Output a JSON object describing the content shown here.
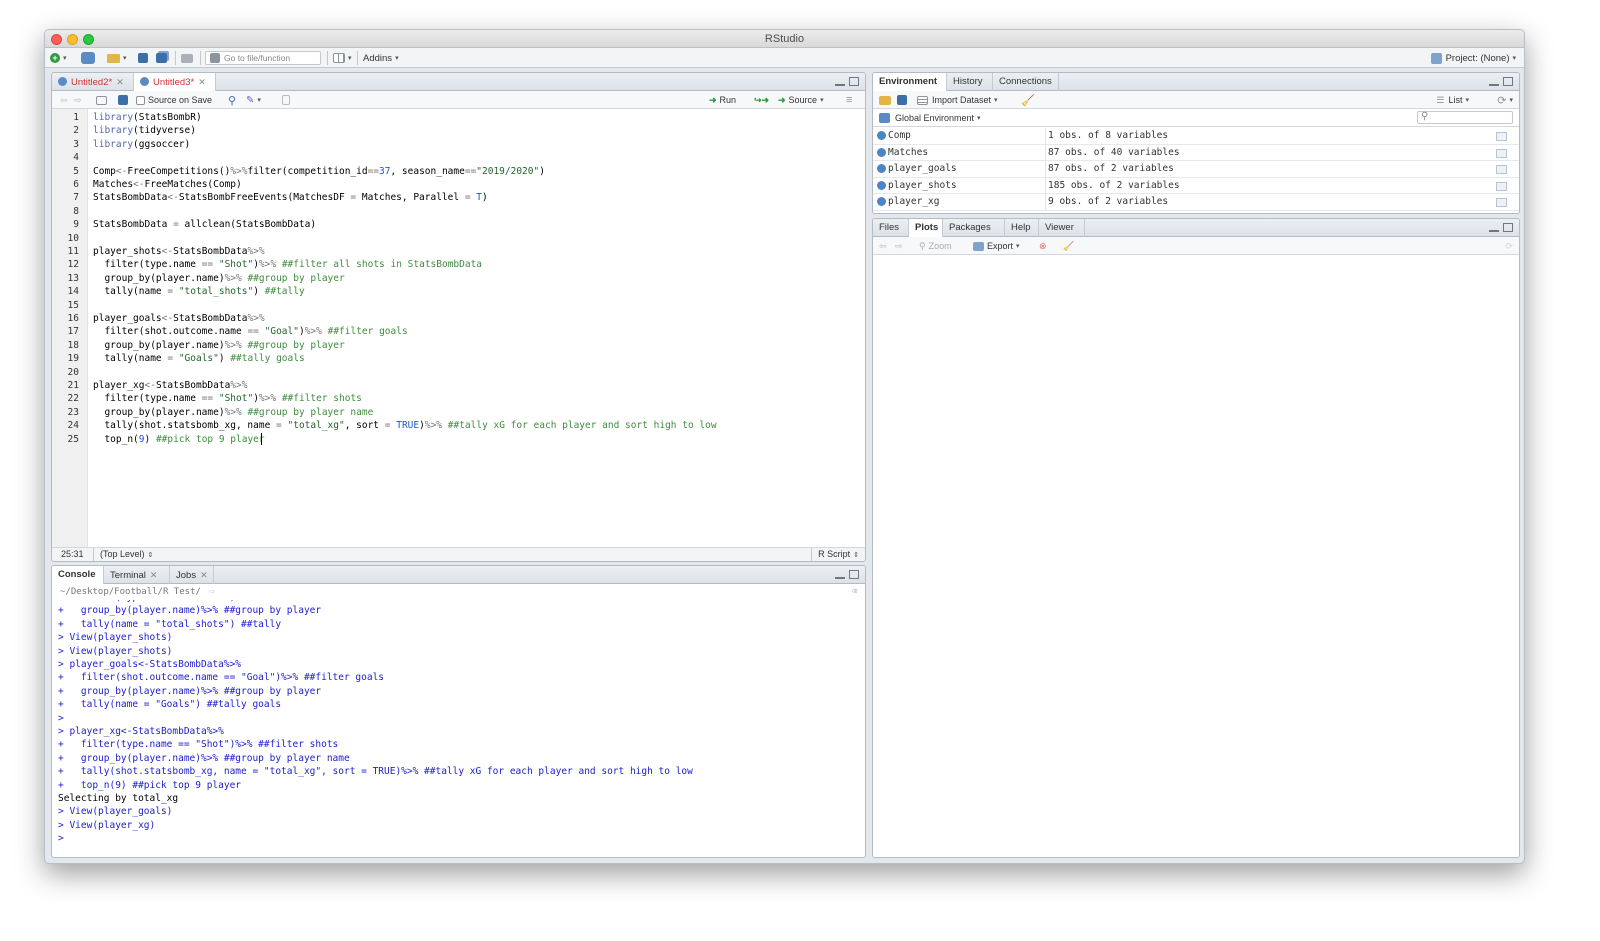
{
  "window": {
    "title": "RStudio"
  },
  "toolbar": {
    "go_to_placeholder": "Go to file/function",
    "addins": "Addins",
    "project": "Project: (None)"
  },
  "editor": {
    "tabs": [
      {
        "label": "Untitled2*"
      },
      {
        "label": "Untitled3*"
      }
    ],
    "source_on_save": "Source on Save",
    "run": "Run",
    "source": "Source",
    "line_numbers": [
      "1",
      "2",
      "3",
      "4",
      "5",
      "6",
      "7",
      "8",
      "9",
      "10",
      "11",
      "12",
      "13",
      "14",
      "15",
      "16",
      "17",
      "18",
      "19",
      "20",
      "21",
      "22",
      "23",
      "24",
      "25"
    ],
    "cursor_pos": "25:31",
    "scope": "(Top Level)",
    "file_type": "R Script"
  },
  "console": {
    "tabs": [
      {
        "label": "Console"
      },
      {
        "label": "Terminal"
      },
      {
        "label": "Jobs"
      }
    ],
    "path": "~/Desktop/Football/R Test/",
    "lines": [
      {
        "text": "+   filter(type.name == \"Shot\")%>% ##filter all shots in StatsBombData",
        "kind": "in"
      },
      {
        "text": "+   group_by(player.name)%>% ##group by player",
        "kind": "in"
      },
      {
        "text": "+   tally(name = \"total_shots\") ##tally",
        "kind": "in"
      },
      {
        "text": "> View(player_shots)",
        "kind": "in"
      },
      {
        "text": "> View(player_shots)",
        "kind": "in"
      },
      {
        "text": "> player_goals<-StatsBombData%>%",
        "kind": "in"
      },
      {
        "text": "+   filter(shot.outcome.name == \"Goal\")%>% ##filter goals",
        "kind": "in"
      },
      {
        "text": "+   group_by(player.name)%>% ##group by player",
        "kind": "in"
      },
      {
        "text": "+   tally(name = \"Goals\") ##tally goals",
        "kind": "in"
      },
      {
        "text": ">",
        "kind": "in"
      },
      {
        "text": "> player_xg<-StatsBombData%>%",
        "kind": "in"
      },
      {
        "text": "+   filter(type.name == \"Shot\")%>% ##filter shots",
        "kind": "in"
      },
      {
        "text": "+   group_by(player.name)%>% ##group by player name",
        "kind": "in"
      },
      {
        "text": "+   tally(shot.statsbomb_xg, name = \"total_xg\", sort = TRUE)%>% ##tally xG for each player and sort high to low",
        "kind": "in"
      },
      {
        "text": "+   top_n(9) ##pick top 9 player",
        "kind": "in"
      },
      {
        "text": "Selecting by total_xg",
        "kind": "out"
      },
      {
        "text": "> View(player_goals)",
        "kind": "in"
      },
      {
        "text": "> View(player_xg)",
        "kind": "in"
      },
      {
        "text": "> ",
        "kind": "in"
      }
    ]
  },
  "env": {
    "tabs": [
      {
        "label": "Environment"
      },
      {
        "label": "History"
      },
      {
        "label": "Connections"
      }
    ],
    "import_dataset": "Import Dataset",
    "view_mode": "List",
    "scope": "Global Environment",
    "rows": [
      {
        "name": "Comp",
        "value": "1 obs. of 8 variables"
      },
      {
        "name": "Matches",
        "value": "87 obs. of 40 variables"
      },
      {
        "name": "player_goals",
        "value": "87 obs. of 2 variables"
      },
      {
        "name": "player_shots",
        "value": "185 obs. of 2 variables"
      },
      {
        "name": "player_xg",
        "value": "9 obs. of 2 variables"
      }
    ]
  },
  "files": {
    "tabs": [
      {
        "label": "Files"
      },
      {
        "label": "Plots"
      },
      {
        "label": "Packages"
      },
      {
        "label": "Help"
      },
      {
        "label": "Viewer"
      }
    ],
    "zoom": "Zoom",
    "export": "Export"
  }
}
